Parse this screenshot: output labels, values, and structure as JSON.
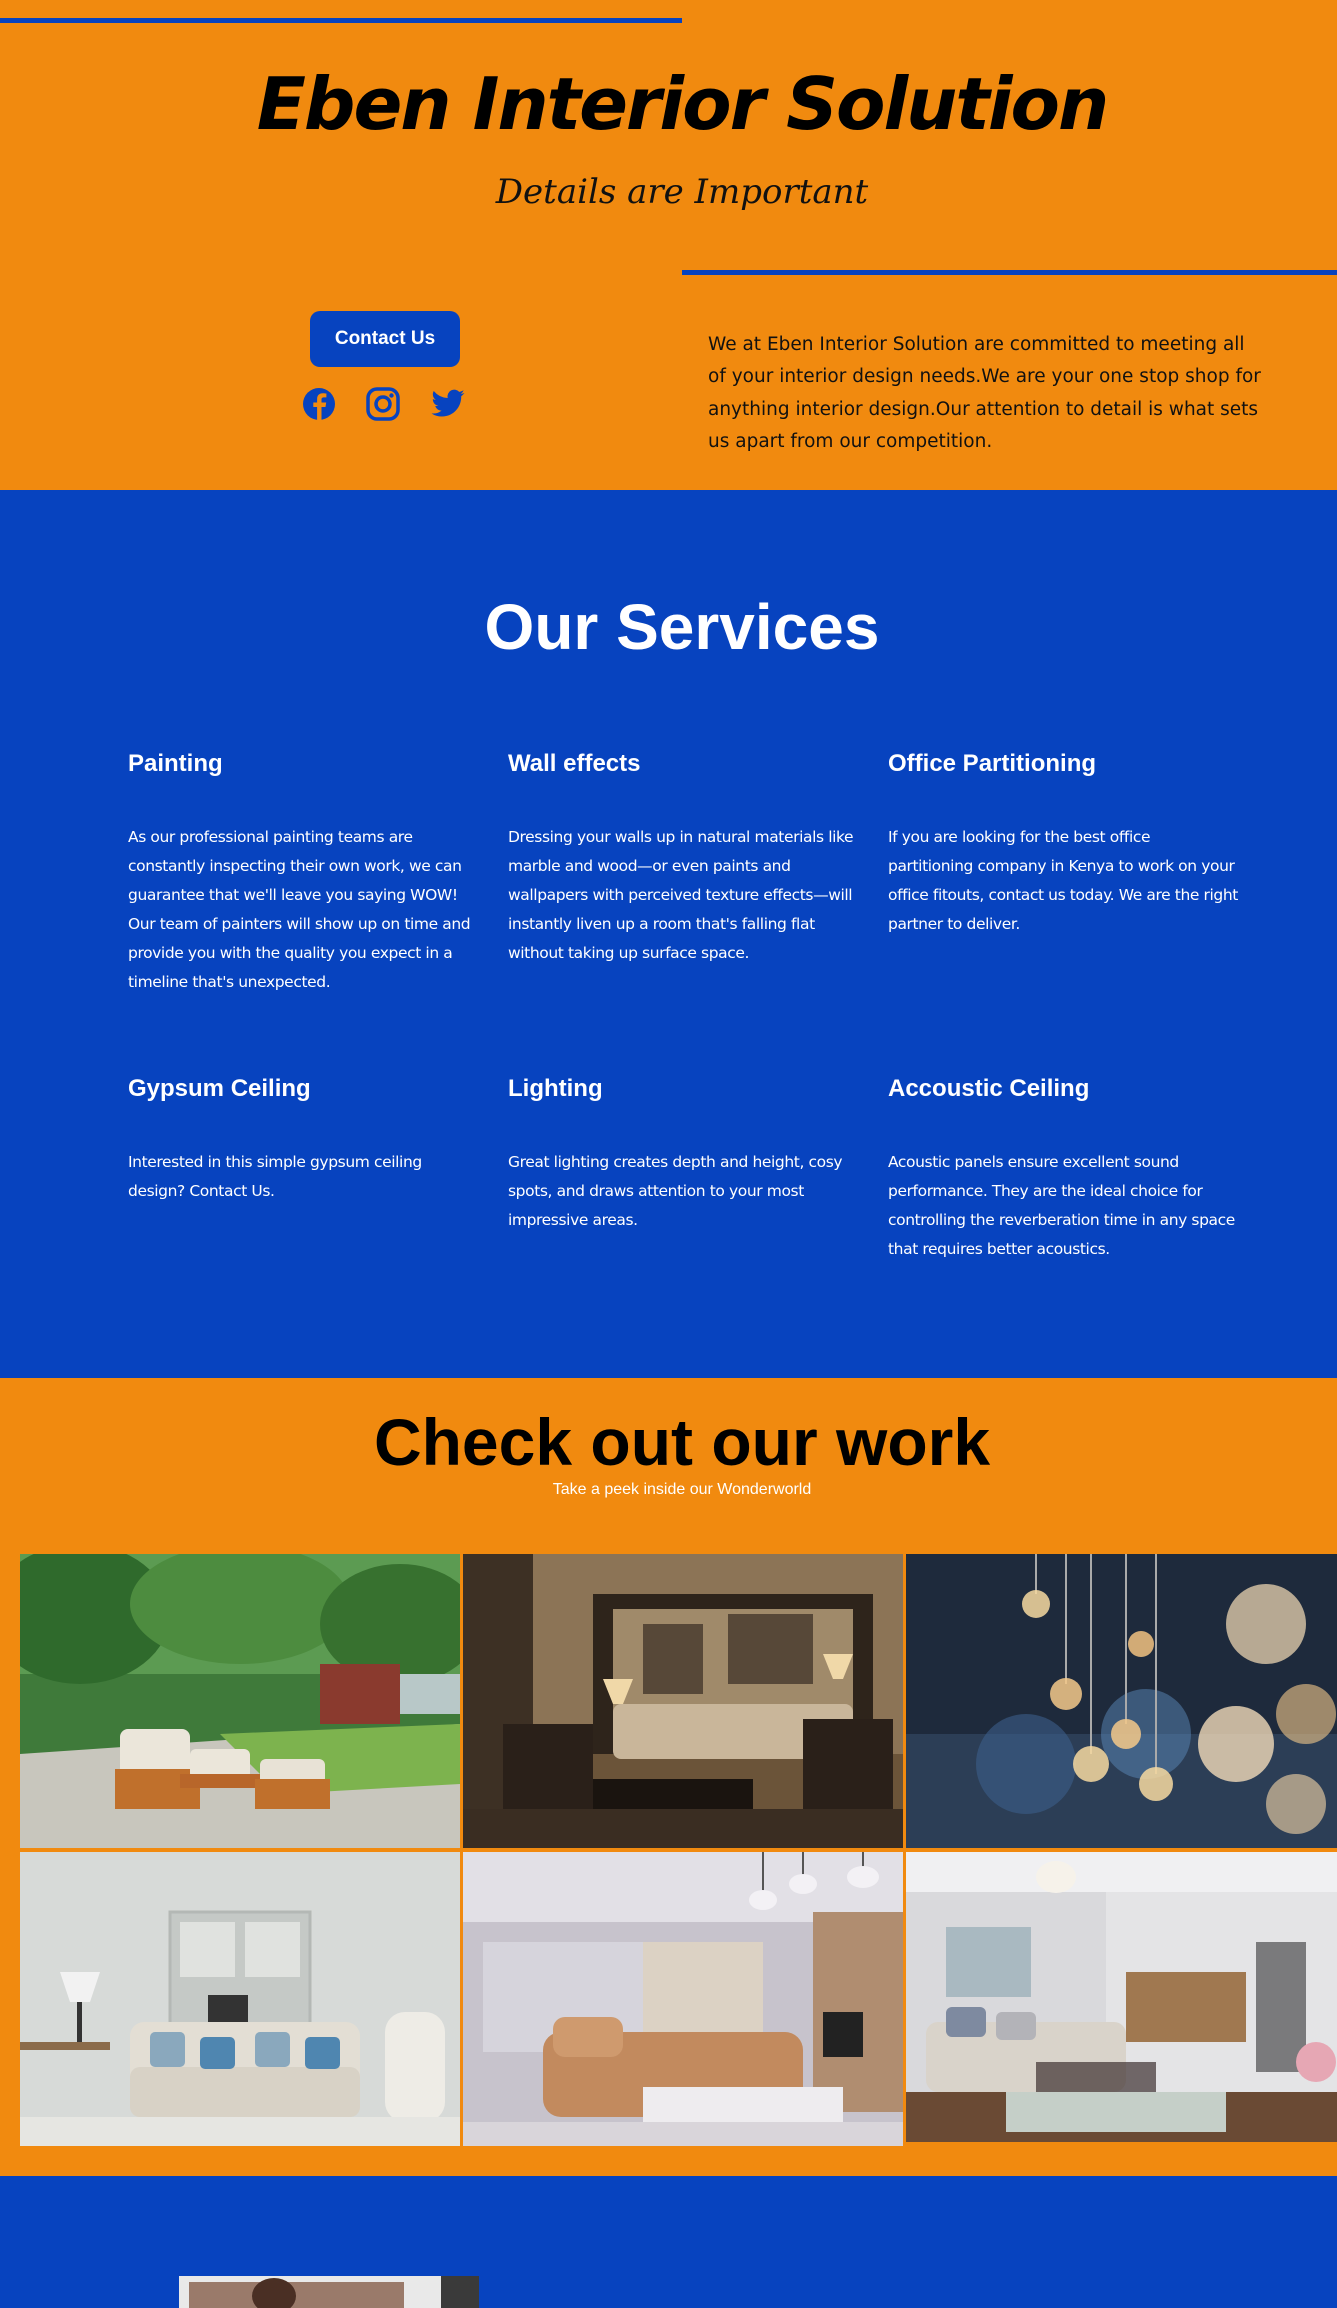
{
  "hero": {
    "title": "Eben Interior Solution",
    "tagline": "Details are Important",
    "contact_label": "Contact Us",
    "description": "We at Eben Interior Solution are committed to meeting all of your interior design needs.We are your one stop shop for anything interior design.Our attention to detail is what sets us apart from our competition.",
    "social_icons": [
      "facebook-icon",
      "instagram-icon",
      "twitter-icon"
    ]
  },
  "services": {
    "title": "Our Services",
    "items": [
      {
        "name": "Painting",
        "text": "As our professional painting teams are constantly inspecting their own work, we can guarantee that we'll leave you saying WOW! Our team of painters will show up on time and provide you with the quality you expect in a timeline that's unexpected."
      },
      {
        "name": "Wall effects",
        "text": "Dressing your walls up in natural materials like marble and wood—or even paints and wallpapers with perceived texture effects—will instantly liven up a room that's falling flat without taking up surface space."
      },
      {
        "name": "Office Partitioning",
        "text": "If you are looking for the best office partitioning company in Kenya to work on your office fitouts, contact us today. We are the right partner to deliver."
      },
      {
        "name": "Gypsum Ceiling",
        "text": "Interested in this simple gypsum ceiling design? Contact Us."
      },
      {
        "name": "Lighting",
        "text": "Great lighting creates depth and height, cosy spots, and draws attention to your most impressive areas."
      },
      {
        "name": "Accoustic Ceiling",
        "text": "Acoustic panels ensure excellent sound performance. They are the ideal choice for controlling the reverberation time in any space that requires better acoustics."
      }
    ]
  },
  "work": {
    "title": "Check out our work",
    "subtitle": "Take a peek inside our Wonderworld"
  },
  "colors": {
    "orange": "#f18a0f",
    "blue": "#0743bf",
    "white": "#ffffff",
    "black": "#000000"
  }
}
